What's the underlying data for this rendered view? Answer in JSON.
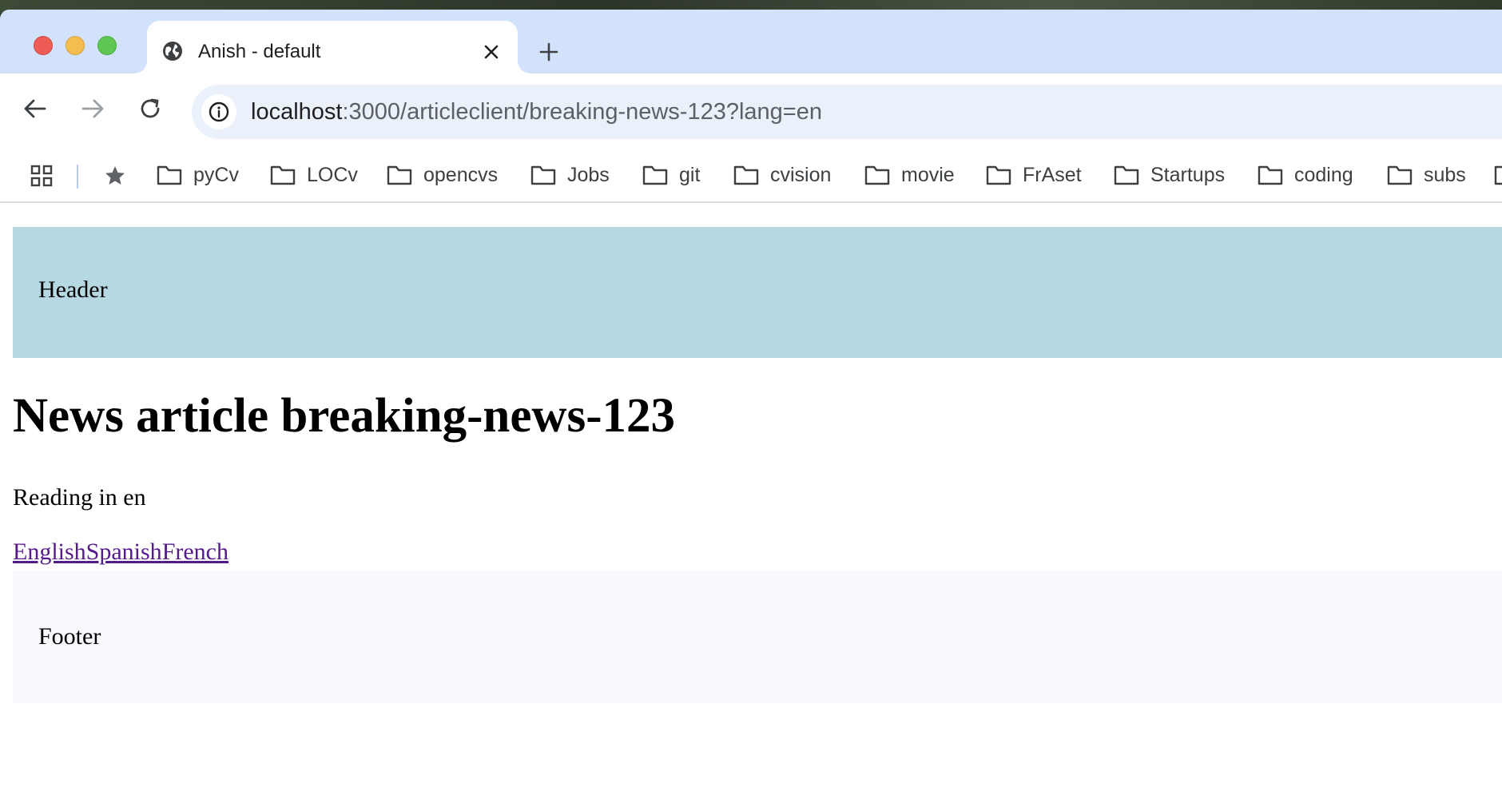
{
  "browser": {
    "tab": {
      "title": "Anish - default"
    },
    "address_bar": {
      "url_host": "localhost",
      "url_rest": ":3000/articleclient/breaking-news-123?lang=en"
    },
    "bookmarks": [
      {
        "label": "pyCv"
      },
      {
        "label": "LOCv"
      },
      {
        "label": "opencvs"
      },
      {
        "label": "Jobs"
      },
      {
        "label": "git"
      },
      {
        "label": "cvision"
      },
      {
        "label": "movie"
      },
      {
        "label": "FrAset"
      },
      {
        "label": "Startups"
      },
      {
        "label": "coding"
      },
      {
        "label": "subs"
      }
    ]
  },
  "page": {
    "header": "Header",
    "title": "News article breaking-news-123",
    "reading": "Reading in en",
    "language_links": [
      "English",
      "Spanish",
      "French"
    ],
    "footer": "Footer"
  },
  "colors": {
    "tab_strip": "#d3e2fb",
    "header_bg": "#b5d8e3",
    "footer_bg": "#f8f8fe",
    "visited_link": "#551a8b"
  },
  "icons": {
    "tab_favicon": "globe-icon",
    "tab_close": "close-icon",
    "new_tab": "plus-icon",
    "back": "arrow-left-icon",
    "forward": "arrow-right-icon",
    "reload": "reload-icon",
    "site_info": "info-icon",
    "apps": "apps-grid-icon",
    "bookmark_star": "star-icon",
    "bookmark_folder": "folder-icon"
  }
}
